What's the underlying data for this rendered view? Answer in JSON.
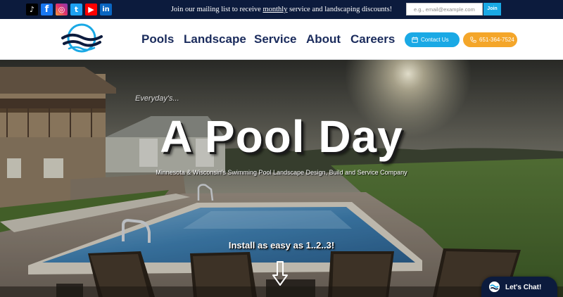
{
  "topbar": {
    "social": [
      {
        "name": "tiktok",
        "glyph": "♪"
      },
      {
        "name": "facebook",
        "glyph": "f"
      },
      {
        "name": "instagram",
        "glyph": "◎"
      },
      {
        "name": "twitter",
        "glyph": "t"
      },
      {
        "name": "youtube",
        "glyph": "▶"
      },
      {
        "name": "linkedin",
        "glyph": "in"
      }
    ],
    "mailing_text_before": "Join our mailing list to receive ",
    "mailing_text_link": "monthly",
    "mailing_text_after": " service and landscaping discounts!",
    "email_placeholder": "e.g., email@example.com",
    "join_label": "Join"
  },
  "header": {
    "nav": [
      "Pools",
      "Landscape",
      "Service",
      "About",
      "Careers"
    ],
    "contact_label": "Contact Us",
    "phone_label": "651-364-7524"
  },
  "hero": {
    "tagline_small": "Everyday's...",
    "title": "A Pool Day",
    "subtitle": "Minnesota & Wisconsin's Swimming Pool Landscape Design, Build and Service Company",
    "install_text": "Install as easy as 1..2..3!"
  },
  "chat": {
    "label": "Let's Chat!"
  },
  "colors": {
    "navy": "#0c1b3d",
    "nav_text": "#1a2b5c",
    "accent_blue": "#1aa9e5",
    "accent_orange": "#f4a62a",
    "pool_water": "#3f7fb0"
  },
  "icons": [
    "tiktok-icon",
    "facebook-icon",
    "instagram-icon",
    "twitter-icon",
    "youtube-icon",
    "linkedin-icon",
    "calendar-icon",
    "phone-icon",
    "chat-icon",
    "down-arrow-icon"
  ]
}
